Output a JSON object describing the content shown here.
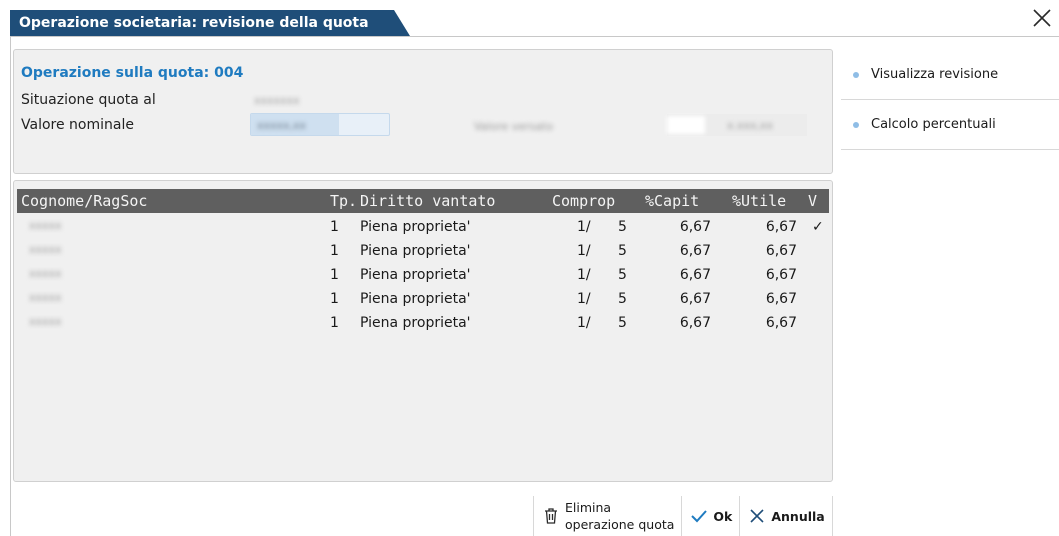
{
  "window": {
    "title": "Operazione societaria: revisione della quota",
    "close_icon": "close-icon"
  },
  "header_panel": {
    "operation_title": "Operazione sulla quota: 004",
    "situation_label": "Situazione quota al",
    "situation_value": "xxxxxxx",
    "nominal_label": "Valore nominale",
    "nominal_value": "xxxxx,xx",
    "versato_label": "Valore versato",
    "versato_value": "x.xxx,xx"
  },
  "grid": {
    "columns": [
      "Cognome/RagSoc",
      "Tp.",
      "Diritto vantato",
      "Comprop",
      "%Capit",
      "%Utile",
      "V"
    ],
    "rows": [
      {
        "name": "xxxxx",
        "tp": "1",
        "diritto": "Piena proprieta'",
        "comp_num": "1/",
        "comp_den": "5",
        "capit": "6,67",
        "utile": "6,67",
        "v": "✓"
      },
      {
        "name": "xxxxx",
        "tp": "1",
        "diritto": "Piena proprieta'",
        "comp_num": "1/",
        "comp_den": "5",
        "capit": "6,67",
        "utile": "6,67",
        "v": ""
      },
      {
        "name": "xxxxx",
        "tp": "1",
        "diritto": "Piena proprieta'",
        "comp_num": "1/",
        "comp_den": "5",
        "capit": "6,67",
        "utile": "6,67",
        "v": ""
      },
      {
        "name": "xxxxx",
        "tp": "1",
        "diritto": "Piena proprieta'",
        "comp_num": "1/",
        "comp_den": "5",
        "capit": "6,67",
        "utile": "6,67",
        "v": ""
      },
      {
        "name": "xxxxx",
        "tp": "1",
        "diritto": "Piena proprieta'",
        "comp_num": "1/",
        "comp_den": "5",
        "capit": "6,67",
        "utile": "6,67",
        "v": ""
      }
    ]
  },
  "side_menu": {
    "items": [
      {
        "label": "Visualizza revisione"
      },
      {
        "label": "Calcolo percentuali"
      }
    ]
  },
  "buttons": {
    "delete_line1": "Elimina",
    "delete_line2": "operazione quota",
    "ok": "Ok",
    "cancel": "Annulla"
  },
  "colors": {
    "title_bg": "#1f4e79",
    "accent": "#1f7bc0",
    "grid_header": "#5f5f5f",
    "panel_bg": "#f0f0f0"
  }
}
